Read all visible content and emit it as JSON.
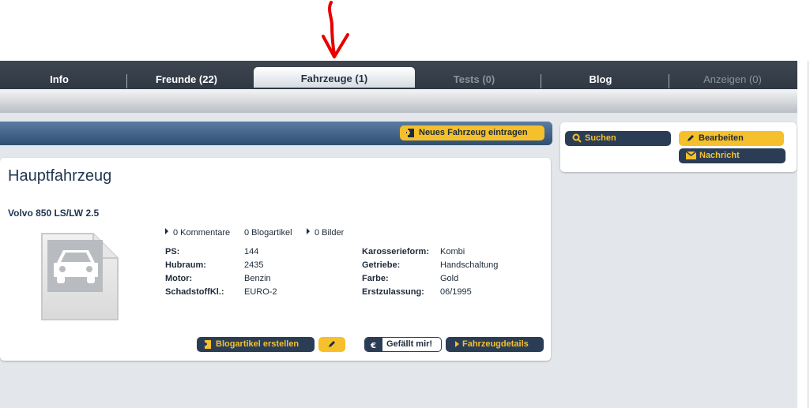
{
  "tabs": [
    {
      "label": "Info",
      "state": "normal"
    },
    {
      "label": "Freunde (22)",
      "state": "normal"
    },
    {
      "label": "Fahrzeuge (1)",
      "state": "active"
    },
    {
      "label": "Tests (0)",
      "state": "disabled"
    },
    {
      "label": "Blog",
      "state": "normal"
    },
    {
      "label": "Anzeigen (0)",
      "state": "disabled"
    }
  ],
  "actions": {
    "new_vehicle": "Neues Fahrzeug eintragen"
  },
  "sidebar": {
    "search": "Suchen",
    "edit": "Bearbeiten",
    "message": "Nachricht"
  },
  "card": {
    "title": "Hauptfahrzeug",
    "vehicle": "Volvo 850 LS/LW 2.5",
    "links": {
      "comments": "0 Kommentare",
      "blog_articles": "0 Blogartikel",
      "images": "0 Bilder"
    },
    "specs_left": [
      {
        "key": "PS:",
        "value": "144"
      },
      {
        "key": "Hubraum:",
        "value": "2435"
      },
      {
        "key": "Motor:",
        "value": "Benzin"
      },
      {
        "key": "SchadstoffKl.:",
        "value": "EURO-2"
      }
    ],
    "specs_right": [
      {
        "key": "Karosserieform:",
        "value": "Kombi"
      },
      {
        "key": "Getriebe:",
        "value": "Handschaltung"
      },
      {
        "key": "Farbe:",
        "value": "Gold"
      },
      {
        "key": "Erstzulassung:",
        "value": "06/1995"
      }
    ],
    "buttons": {
      "create_blog": "Blogartikel erstellen",
      "like": "Gefällt mir!",
      "details": "Fahrzeugdetails"
    }
  },
  "colors": {
    "tabbar": "#2f3843",
    "accent_yellow": "#f5c02b",
    "dark_button": "#2a3d55",
    "annotation_arrow": "#e60000"
  }
}
